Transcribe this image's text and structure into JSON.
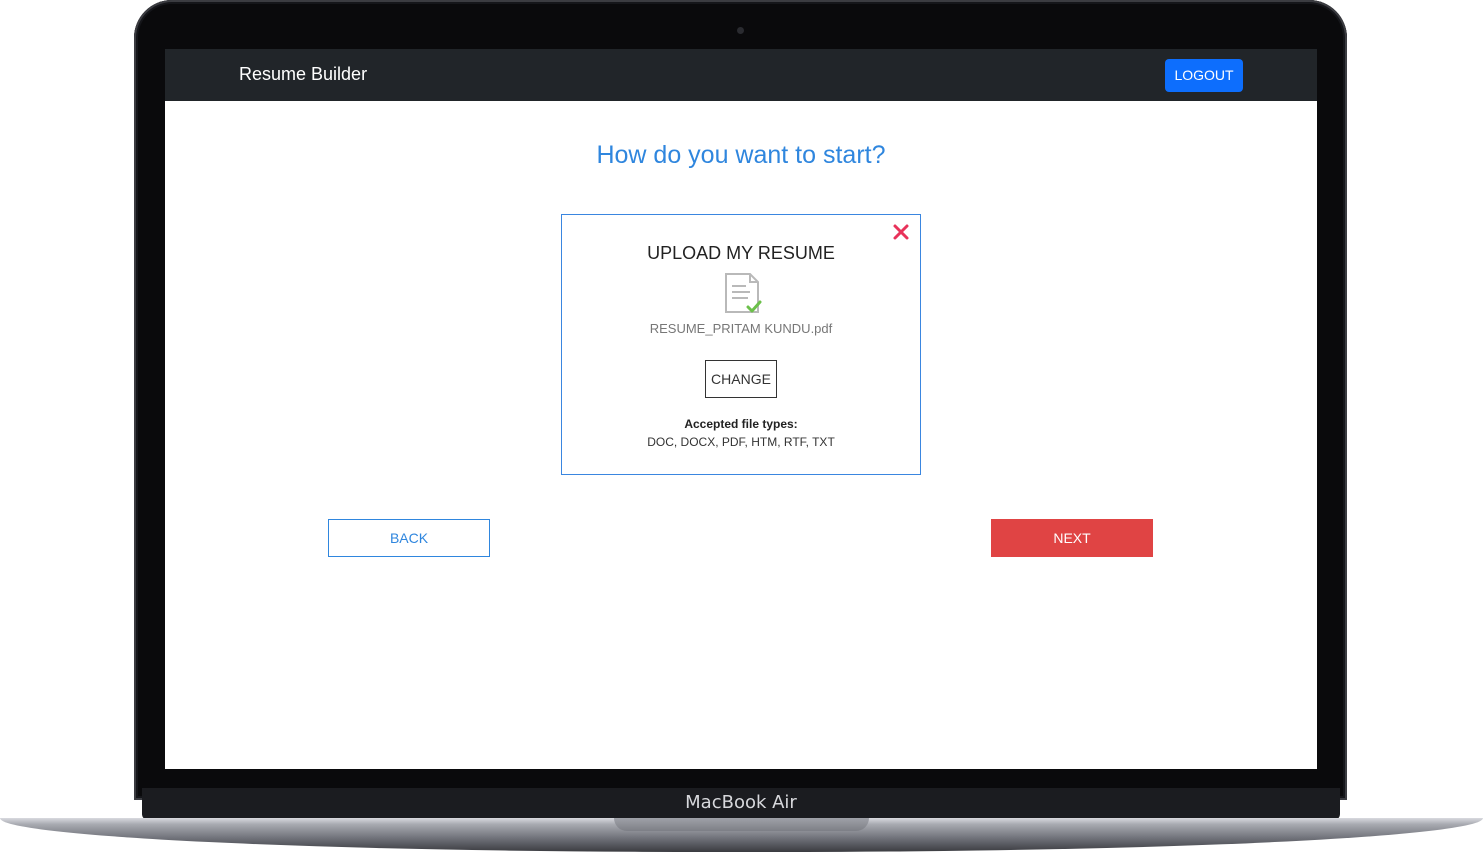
{
  "device": {
    "model_label": "MacBook Air"
  },
  "navbar": {
    "brand": "Resume Builder",
    "logout_label": "LOGOUT"
  },
  "main": {
    "heading": "How do you want to start?",
    "upload_card": {
      "title": "UPLOAD MY RESUME",
      "file_name": "RESUME_PRITAM KUNDU.pdf",
      "change_label": "CHANGE",
      "accepted_label": "Accepted file types:",
      "accepted_types": "DOC, DOCX, PDF, HTM, RTF, TXT",
      "status_icon": "document-check-icon",
      "close_icon": "close-icon"
    },
    "back_label": "BACK",
    "next_label": "NEXT"
  },
  "colors": {
    "navbar_bg": "#212529",
    "primary_blue": "#0d6efd",
    "heading_blue": "#2f86de",
    "next_red": "#e04444",
    "close_pink": "#e8325a",
    "check_green": "#6cc04a"
  }
}
